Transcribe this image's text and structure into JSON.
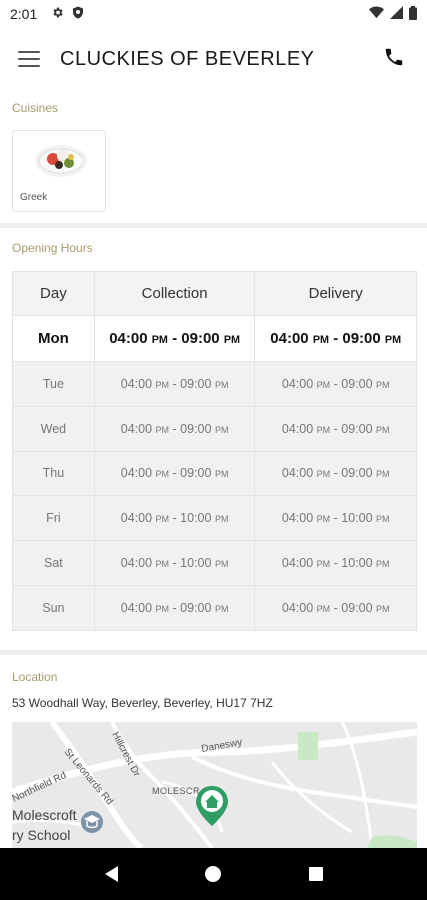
{
  "status_bar": {
    "time": "2:01"
  },
  "app_bar": {
    "title": "CLUCKIES OF BEVERLEY"
  },
  "cuisines": {
    "label": "Cuisines",
    "items": [
      {
        "name": "Greek"
      }
    ]
  },
  "opening_hours": {
    "label": "Opening Hours",
    "headers": {
      "day": "Day",
      "collection": "Collection",
      "delivery": "Delivery"
    },
    "rows": [
      {
        "day": "Mon",
        "c_open": "04:00",
        "c_close": "09:00",
        "d_open": "04:00",
        "d_close": "09:00"
      },
      {
        "day": "Tue",
        "c_open": "04:00",
        "c_close": "09:00",
        "d_open": "04:00",
        "d_close": "09:00"
      },
      {
        "day": "Wed",
        "c_open": "04:00",
        "c_close": "09:00",
        "d_open": "04:00",
        "d_close": "09:00"
      },
      {
        "day": "Thu",
        "c_open": "04:00",
        "c_close": "09:00",
        "d_open": "04:00",
        "d_close": "09:00"
      },
      {
        "day": "Fri",
        "c_open": "04:00",
        "c_close": "10:00",
        "d_open": "04:00",
        "d_close": "10:00"
      },
      {
        "day": "Sat",
        "c_open": "04:00",
        "c_close": "10:00",
        "d_open": "04:00",
        "d_close": "10:00"
      },
      {
        "day": "Sun",
        "c_open": "04:00",
        "c_close": "09:00",
        "d_open": "04:00",
        "d_close": "09:00"
      }
    ],
    "period": "PM",
    "separator": "-"
  },
  "location": {
    "label": "Location",
    "address": "53 Woodhall Way, Beverley, Beverley, HU17 7HZ",
    "map_labels": {
      "street_1": "St Leonards Rd",
      "street_2": "Hillcrest Dr",
      "street_3": "Daneswy",
      "street_4": "Northfield Rd",
      "area": "MOLESCR",
      "school_1": "Molescroft",
      "school_2": "ry School"
    }
  },
  "colors": {
    "section_label": "#a69a6c",
    "map_pin": "#2e9e63"
  }
}
